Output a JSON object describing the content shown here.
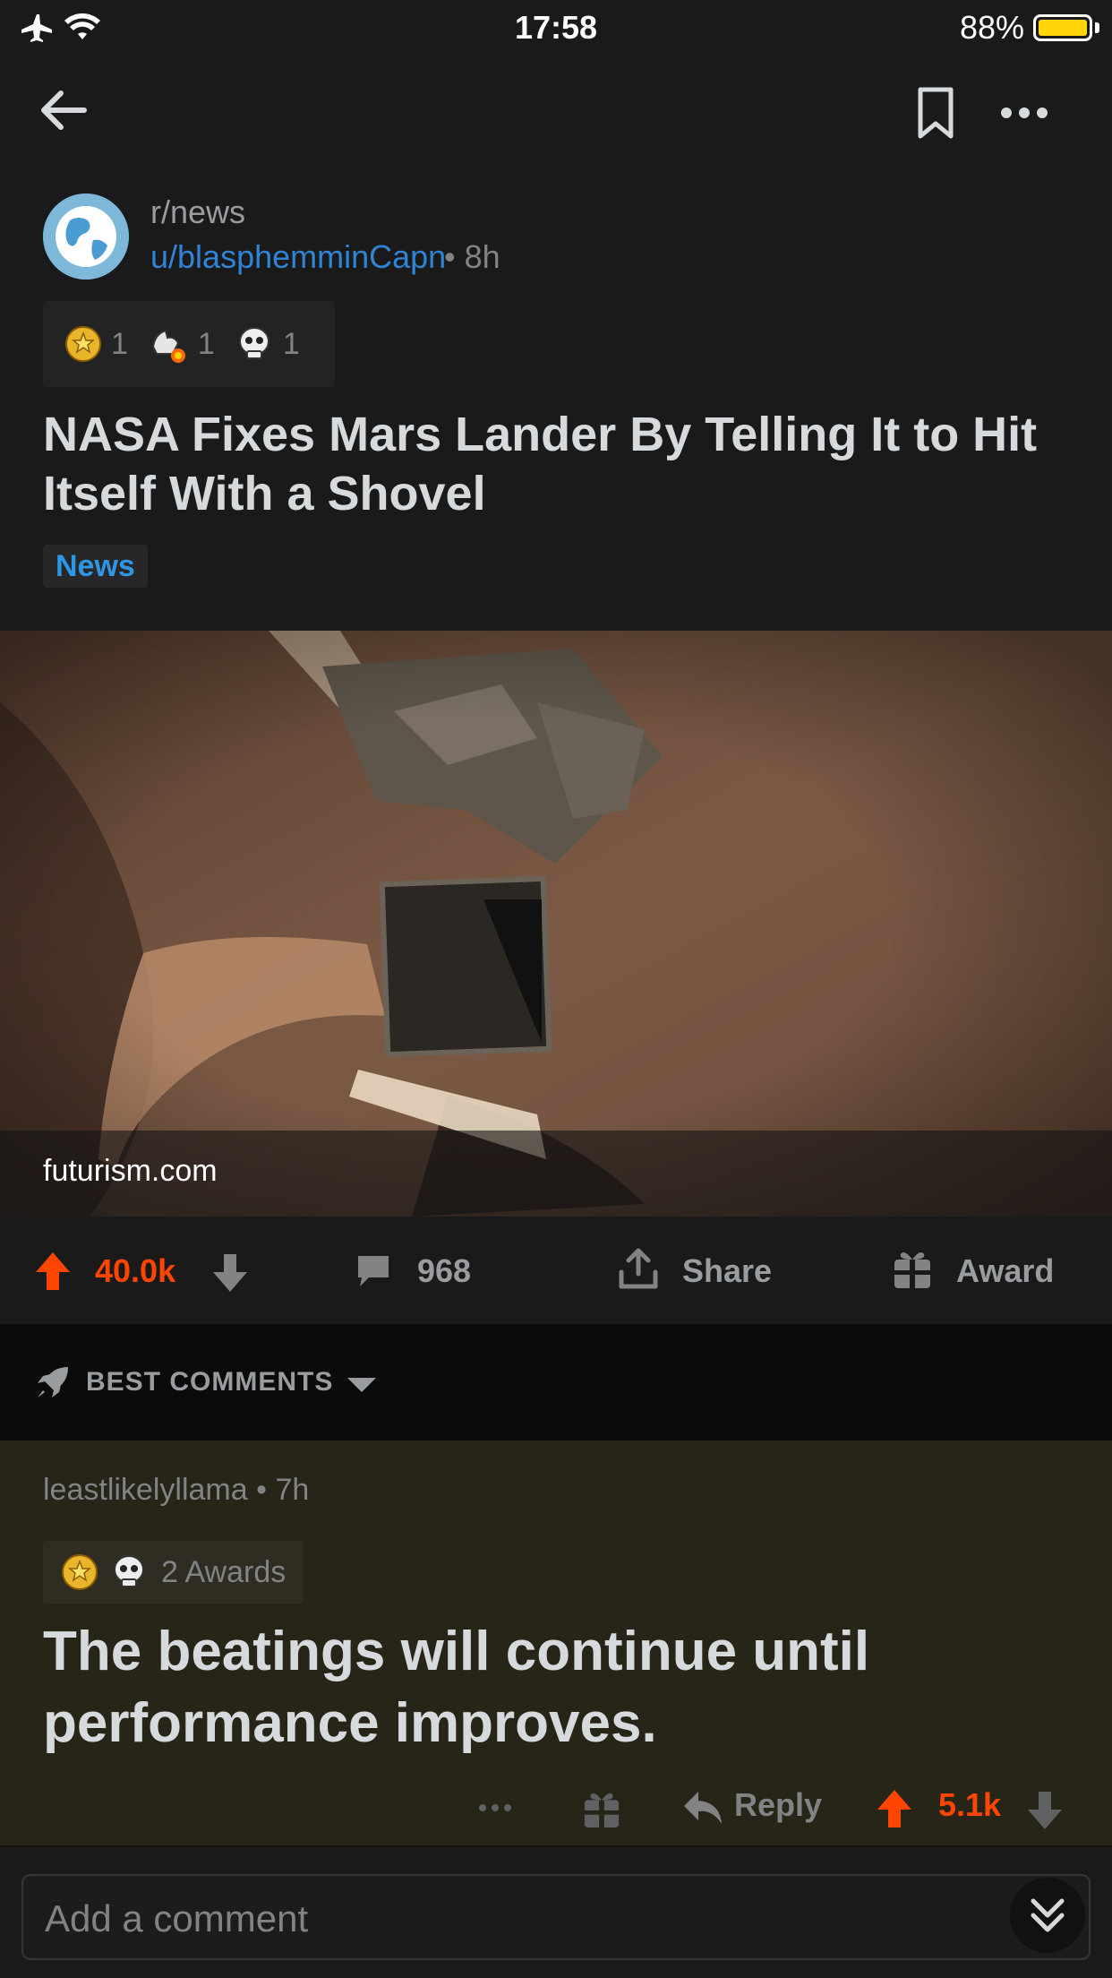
{
  "status_bar": {
    "time": "17:58",
    "battery": "88%"
  },
  "post": {
    "subreddit": "r/news",
    "author": "u/blasphemminCapn",
    "age": "• 8h",
    "awards": [
      {
        "icon": "gold-award-icon",
        "count": "1"
      },
      {
        "icon": "rocket-like-award-icon",
        "count": "1"
      },
      {
        "icon": "skull-award-icon",
        "count": "1"
      }
    ],
    "title": "NASA Fixes Mars Lander By Telling It to Hit Itself With a Shovel",
    "flair": "News",
    "domain": "futurism.com",
    "votes": "40.0k",
    "comments": "968",
    "share_label": "Share",
    "award_label": "Award"
  },
  "sort": {
    "label": "BEST COMMENTS"
  },
  "comment": {
    "author": "leastlikelyllama",
    "age": "• 7h",
    "awards_text": "2 Awards",
    "body": "The beatings will continue until performance improves.",
    "reply_label": "Reply",
    "votes": "5.1k"
  },
  "composer": {
    "placeholder": "Add a comment"
  },
  "colors": {
    "upvote": "#ff4500",
    "link": "#2f84d6",
    "background": "#1a1a1b",
    "comment_highlight": "#272418"
  }
}
